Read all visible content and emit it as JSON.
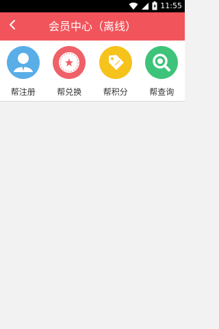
{
  "status_bar": {
    "time": "11:55",
    "icons": [
      "wifi-icon",
      "signal-icon",
      "battery-icon"
    ]
  },
  "app_bar": {
    "title": "会员中心（离线）",
    "back_icon": "chevron-left-icon",
    "background": "#f2545b"
  },
  "menu": {
    "items": [
      {
        "label": "帮注册",
        "icon": "user-icon",
        "color": "#5aaee8"
      },
      {
        "label": "帮兑换",
        "icon": "star-badge-icon",
        "color": "#f06068"
      },
      {
        "label": "帮积分",
        "icon": "tag-icon",
        "color": "#f6c21c"
      },
      {
        "label": "帮查询",
        "icon": "search-icon",
        "color": "#3ec47a"
      }
    ]
  }
}
